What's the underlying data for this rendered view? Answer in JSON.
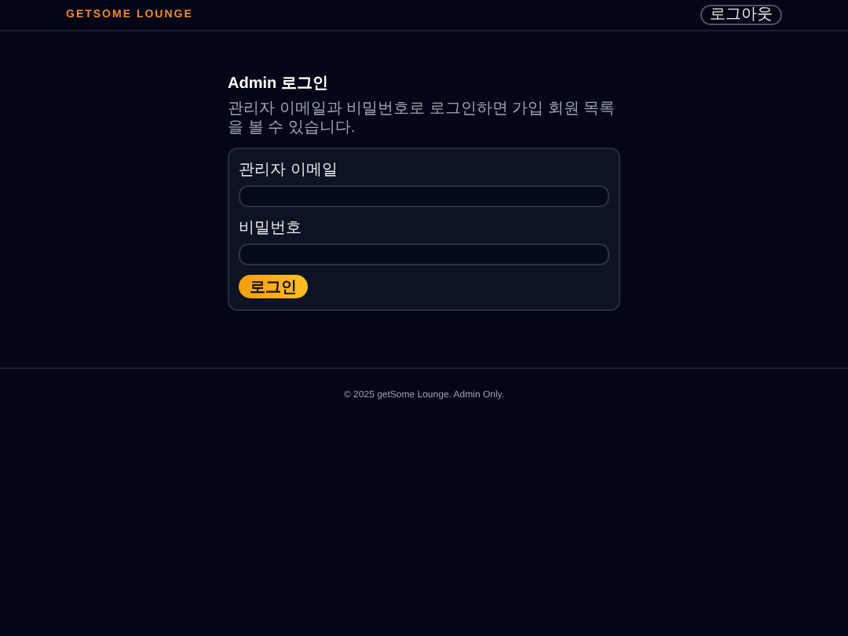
{
  "header": {
    "brand": "GETSOME LOUNGE",
    "logout_button": "로그아웃"
  },
  "login": {
    "title": "Admin 로그인",
    "description": "관리자 이메일과 비밀번호로 로그인하면 가입 회원 목록을 볼 수 있습니다.",
    "fields": [
      {
        "label": "관리자 이메일"
      },
      {
        "label": "비밀번호"
      }
    ],
    "submit_button": "로그인"
  },
  "footer": {
    "text": "© 2025 getSome Lounge. Admin Only."
  }
}
